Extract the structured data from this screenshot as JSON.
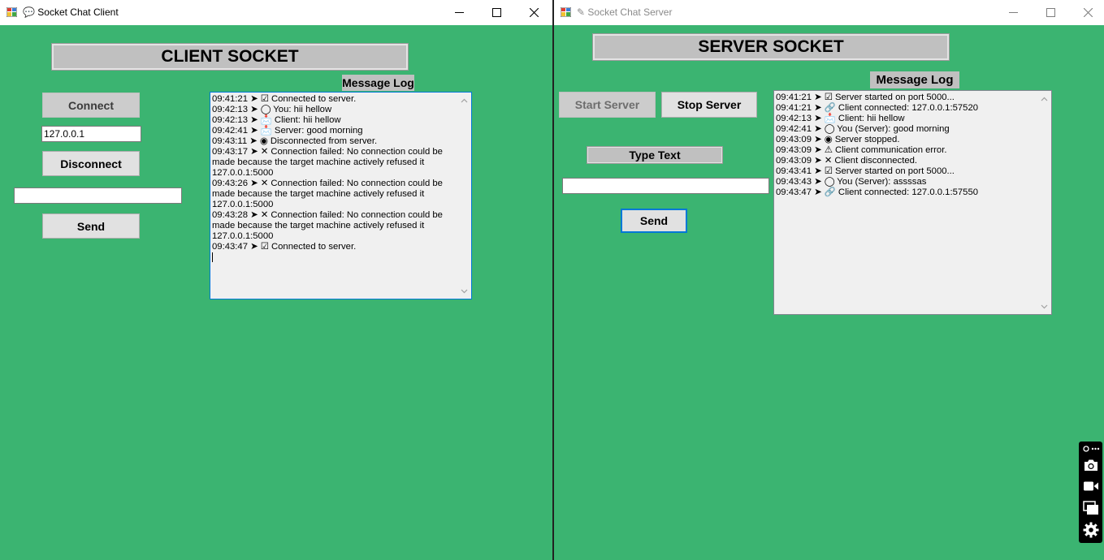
{
  "client": {
    "window_title": "💬 Socket Chat Client",
    "heading": "CLIENT SOCKET",
    "connect_label": "Connect",
    "ip_value": "127.0.0.1",
    "disconnect_label": "Disconnect",
    "message_value": "",
    "send_label": "Send",
    "log_label": "Message Log",
    "log_lines": [
      "09:41:21 ➤ ☑ Connected to server.",
      "09:42:13 ➤ ◯ You: hii hellow",
      "09:42:13 ➤ 📩 Client: hii hellow",
      "09:42:41 ➤ 📩 Server: good morning",
      "09:43:11 ➤ ◉ Disconnected from server.",
      "09:43:17 ➤ ✕ Connection failed: No connection could be made because the target machine actively refused it 127.0.0.1:5000",
      "09:43:26 ➤ ✕ Connection failed: No connection could be made because the target machine actively refused it 127.0.0.1:5000",
      "09:43:28 ➤ ✕ Connection failed: No connection could be made because the target machine actively refused it 127.0.0.1:5000",
      "09:43:47 ➤ ☑ Connected to server."
    ]
  },
  "server": {
    "window_title": "✎ Socket Chat Server",
    "heading": "SERVER SOCKET",
    "start_label": "Start Server",
    "stop_label": "Stop Server",
    "type_text_label": "Type Text",
    "message_value": "",
    "send_label": "Send",
    "log_label": "Message Log",
    "log_lines": [
      "09:41:21 ➤ ☑ Server started on port 5000...",
      "09:41:21 ➤ 🔗 Client connected: 127.0.0.1:57520",
      "09:42:13 ➤ 📩 Client: hii hellow",
      "09:42:41 ➤ ◯ You (Server): good morning",
      "09:43:09 ➤ ◉ Server stopped.",
      "09:43:09 ➤ ⚠ Client communication error.",
      "09:43:09 ➤ ✕ Client disconnected.",
      "09:43:41 ➤ ☑ Server started on port 5000...",
      "09:43:43 ➤ ◯ You (Server): assssas",
      "09:43:47 ➤ 🔗 Client connected: 127.0.0.1:57550"
    ]
  },
  "icons": {
    "app": "app-window-icon",
    "minimize": "minimize-icon",
    "maximize": "maximize-icon",
    "close": "close-icon",
    "camera": "camera-icon",
    "video": "video-camera-icon",
    "screens": "screens-icon",
    "settings": "gear-icon"
  },
  "colors": {
    "window_bg": "#3bb471",
    "focus": "#0078d7"
  }
}
